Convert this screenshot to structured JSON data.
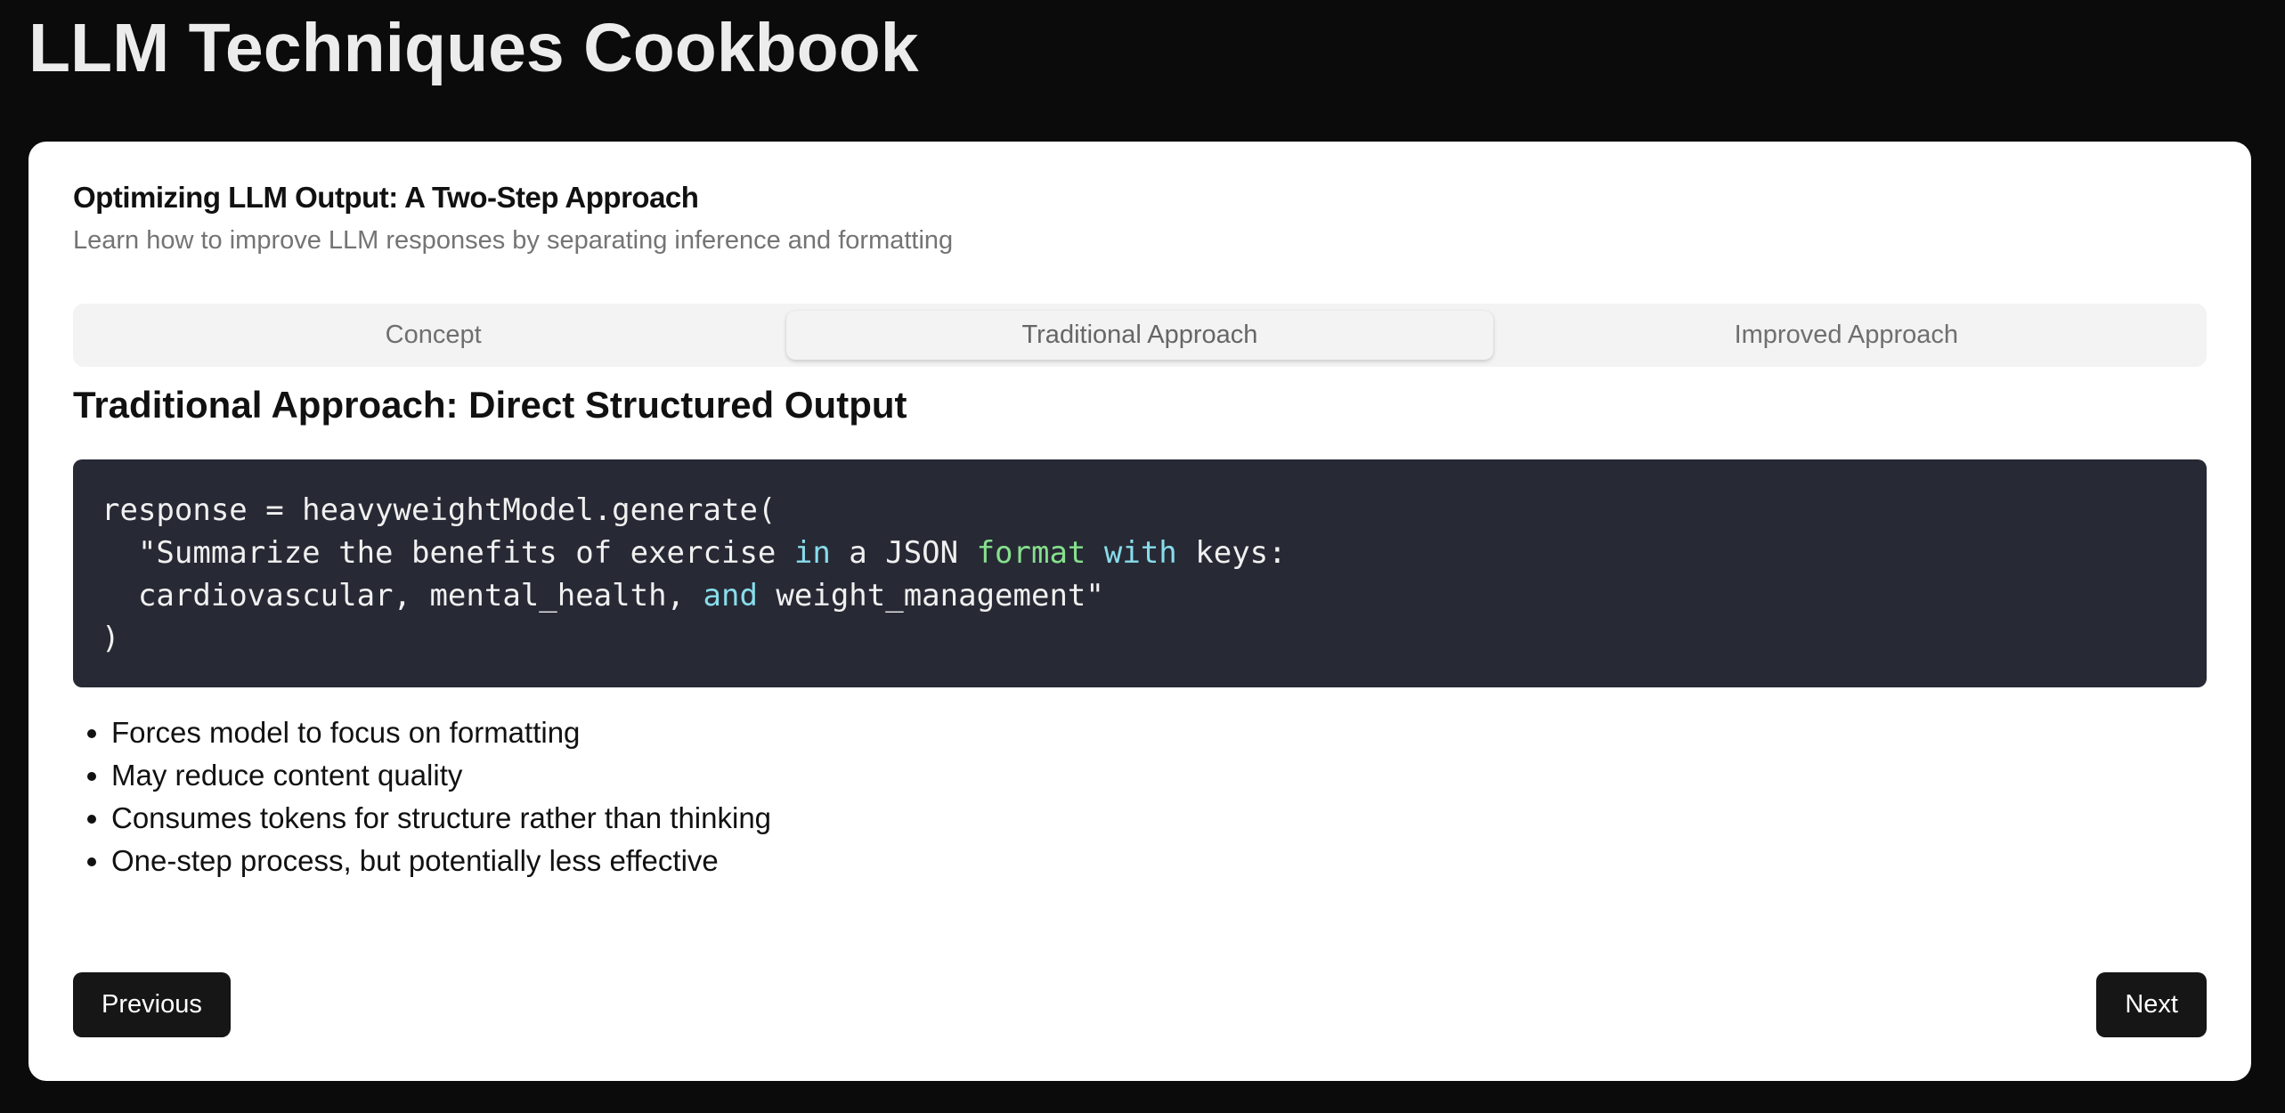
{
  "app": {
    "title": "LLM Techniques Cookbook"
  },
  "card": {
    "title": "Optimizing LLM Output: A Two-Step Approach",
    "subtitle": "Learn how to improve LLM responses by separating inference and formatting"
  },
  "tabs": [
    {
      "label": "Concept",
      "active": false
    },
    {
      "label": "Traditional Approach",
      "active": true
    },
    {
      "label": "Improved Approach",
      "active": false
    }
  ],
  "section": {
    "title": "Traditional Approach: Direct Structured Output"
  },
  "code": {
    "lines": [
      [
        {
          "text": "response = heavyweightModel.generate(",
          "kind": "plain"
        }
      ],
      [
        {
          "text": "  \"Summarize the benefits of exercise ",
          "kind": "plain"
        },
        {
          "text": "in",
          "kind": "keyword"
        },
        {
          "text": " a JSON ",
          "kind": "plain"
        },
        {
          "text": "format",
          "kind": "function"
        },
        {
          "text": " ",
          "kind": "plain"
        },
        {
          "text": "with",
          "kind": "keyword"
        },
        {
          "text": " keys:",
          "kind": "plain"
        }
      ],
      [
        {
          "text": "  cardiovascular, mental_health, ",
          "kind": "plain"
        },
        {
          "text": "and",
          "kind": "keyword"
        },
        {
          "text": " weight_management\"",
          "kind": "plain"
        }
      ],
      [
        {
          "text": ")",
          "kind": "plain"
        }
      ]
    ]
  },
  "bullets": [
    "Forces model to focus on formatting",
    "May reduce content quality",
    "Consumes tokens for structure rather than thinking",
    "One-step process, but potentially less effective"
  ],
  "nav": {
    "previous_label": "Previous",
    "next_label": "Next"
  },
  "colors": {
    "page_background": "#0b0b0b",
    "code_background": "#272a35",
    "code_keyword": "#89dceb",
    "code_function": "#86e08c",
    "button_background": "#161616"
  }
}
